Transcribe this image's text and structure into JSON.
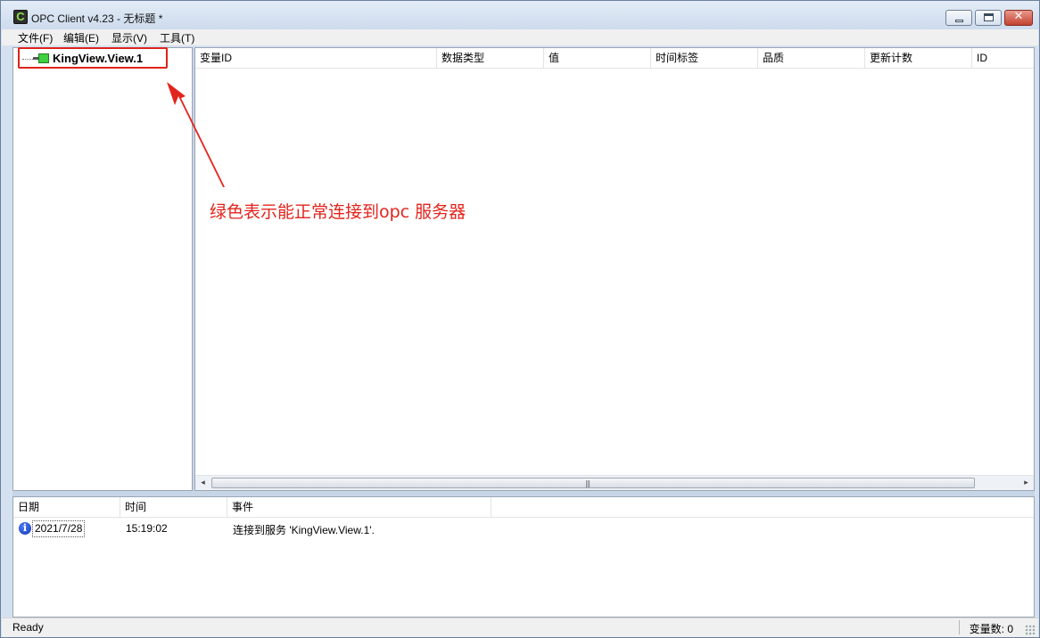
{
  "window": {
    "title": "OPC Client v4.23 - 无标题 *",
    "app_icon_letter": "C"
  },
  "menu": [
    {
      "label": "文件(F)"
    },
    {
      "label": "编辑(E)"
    },
    {
      "label": "显示(V)"
    },
    {
      "label": "工具(T)"
    }
  ],
  "tree": {
    "server_name": "KingView.View.1",
    "server_status_color": "#3fd13f"
  },
  "items_table": {
    "columns": [
      "变量ID",
      "数据类型",
      "值",
      "时间标签",
      "品质",
      "更新计数",
      "ID"
    ],
    "rows": []
  },
  "annotation": {
    "text": "绿色表示能正常连接到opc 服务器",
    "color": "#e3241c"
  },
  "log_table": {
    "columns": [
      "日期",
      "时间",
      "事件"
    ],
    "rows": [
      {
        "icon": "info-icon",
        "date": "2021/7/28",
        "time": "15:19:02",
        "event": "连接到服务 'KingView.View.1'."
      }
    ]
  },
  "status": {
    "left": "Ready",
    "right": "变量数: 0"
  },
  "scrollbar": {
    "left_arrow": "◂",
    "right_arrow": "▸",
    "grip": "|||"
  }
}
